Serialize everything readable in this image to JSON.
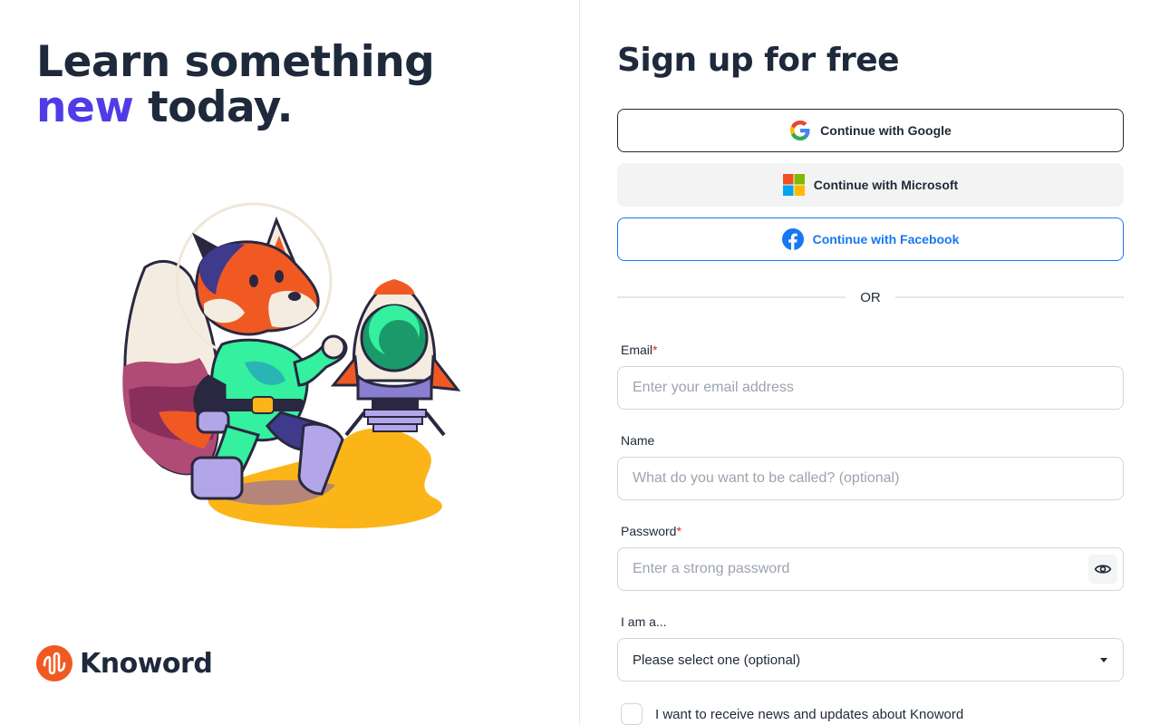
{
  "hero": {
    "headline_line1": "Learn something",
    "headline_accent": "new",
    "headline_rest": " today.",
    "accent_color": "#4f3ce8"
  },
  "illustration": {
    "description": "fox-astronaut-with-rocket"
  },
  "brand": {
    "name": "Knoword",
    "logo_color": "#f05a22"
  },
  "signup": {
    "title": "Sign up for free",
    "sso": {
      "google_label": "Continue with Google",
      "microsoft_label": "Continue with Microsoft",
      "facebook_label": "Continue with Facebook"
    },
    "divider_label": "OR",
    "fields": {
      "email": {
        "label": "Email",
        "required_mark": "*",
        "placeholder": "Enter your email address",
        "value": ""
      },
      "name": {
        "label": "Name",
        "placeholder": "What do you want to be called? (optional)",
        "value": ""
      },
      "password": {
        "label": "Password",
        "required_mark": "*",
        "placeholder": "Enter a strong password",
        "value": ""
      },
      "role": {
        "label": "I am a...",
        "selected": "Please select one (optional)"
      }
    },
    "newsletter": {
      "label": "I want to receive news and updates about Knoword",
      "checked": false
    }
  }
}
